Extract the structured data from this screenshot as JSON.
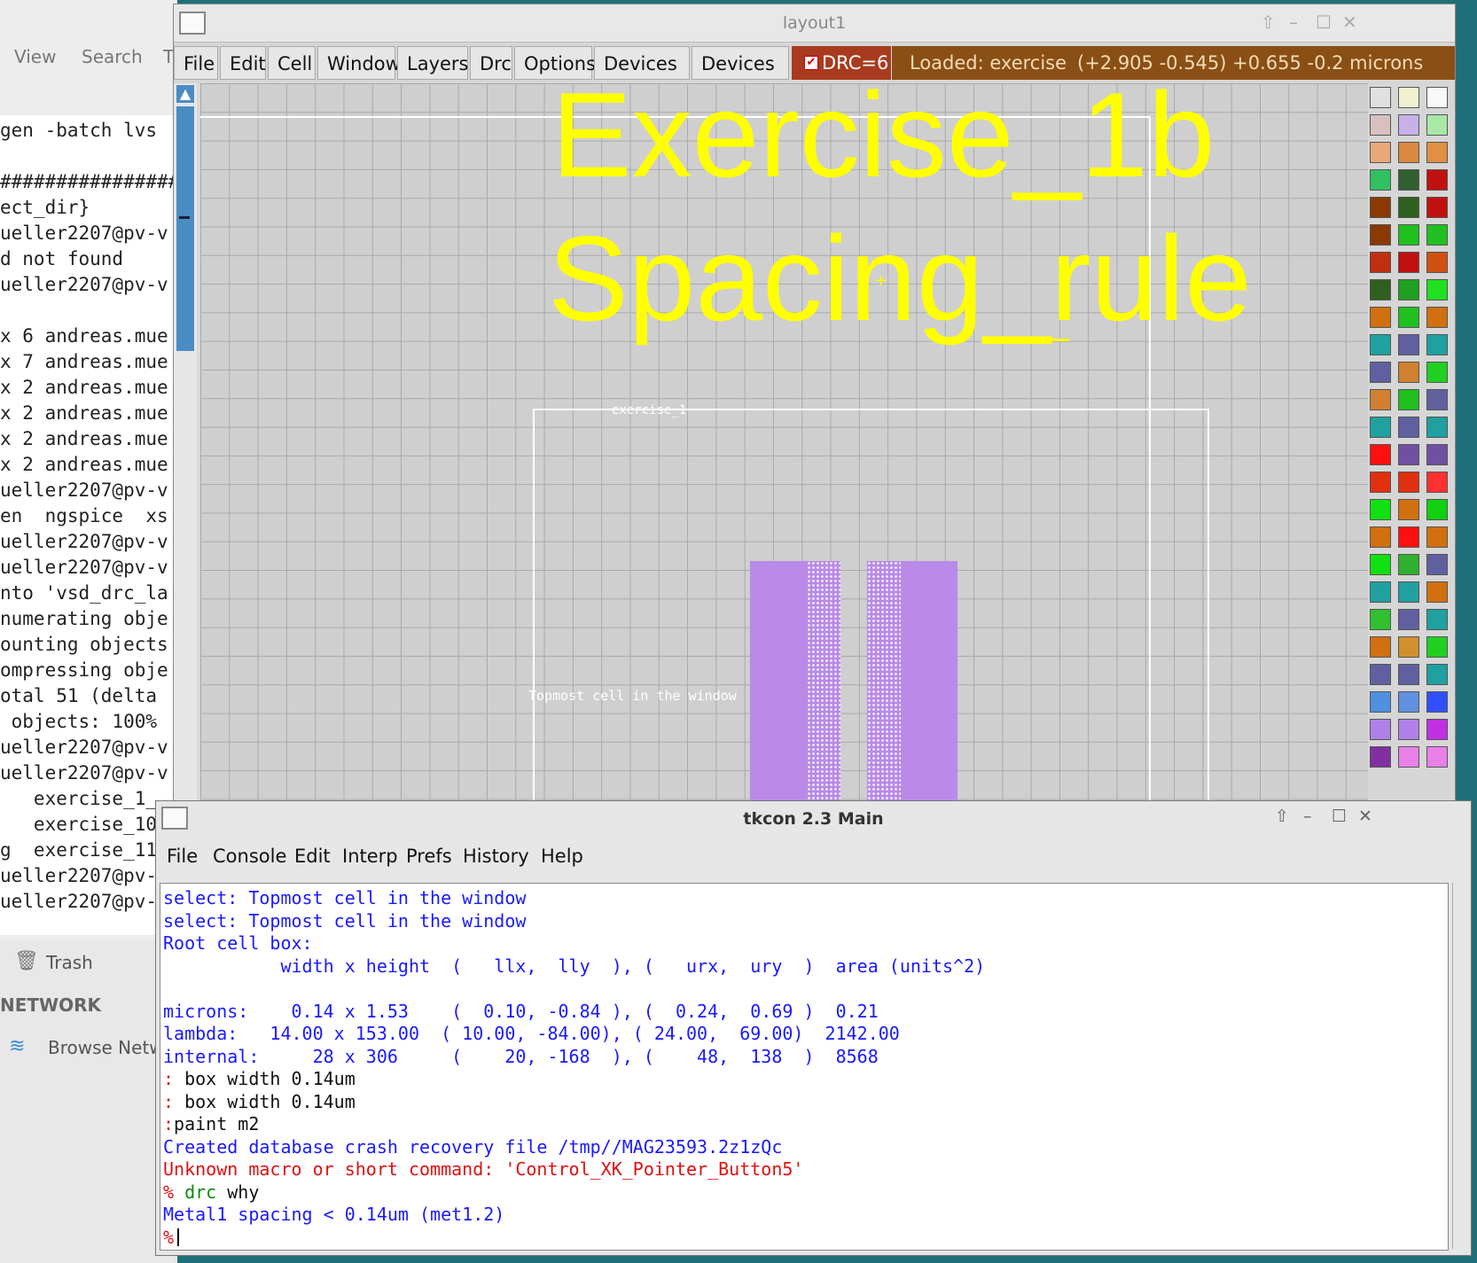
{
  "background": {
    "menu": [
      "View",
      "Search",
      "T"
    ],
    "terminal_lines": [
      "gen -batch lvs",
      "",
      "################",
      "ect_dir}",
      "ueller2207@pv-v",
      "d not found",
      "ueller2207@pv-v",
      "",
      "x 6 andreas.mue",
      "x 7 andreas.mue",
      "x 2 andreas.mue",
      "x 2 andreas.mue",
      "x 2 andreas.mue",
      "x 2 andreas.mue",
      "ueller2207@pv-v",
      "en  ngspice  xs",
      "ueller2207@pv-v",
      "ueller2207@pv-v",
      "nto 'vsd_drc_la",
      "numerating obje",
      "ounting objects",
      "ompressing obje",
      "otal 51 (delta",
      " objects: 100%",
      "ueller2207@pv-v",
      "ueller2207@pv-v",
      "   exercise_1_",
      "   exercise_10",
      "g  exercise_11",
      "ueller2207@pv-",
      "ueller2207@pv-"
    ],
    "sidebar": {
      "trash": "Trash",
      "network": "NETWORK",
      "browse": "Browse Netw"
    }
  },
  "layout": {
    "title": "layout1",
    "menu": [
      "File",
      "Edit",
      "Cell",
      "Window",
      "Layers",
      "Drc",
      "Options",
      "Devices 1",
      "Devices 2"
    ],
    "drc_label": "DRC=6",
    "status_loaded": "Loaded: exercise",
    "status_coords": "(+2.905 -0.545) +0.655 -0.2 microns",
    "canvas": {
      "title_line1": "Exercise_1b",
      "title_line2": "Spacing_rule",
      "cell_name": "exercise_1",
      "topmost_label": "Topmost cell in the window"
    }
  },
  "tkcon": {
    "title": "tkcon 2.3 Main",
    "menu": [
      "File",
      "Console",
      "Edit",
      "Interp",
      "Prefs",
      "History",
      "Help"
    ],
    "lines": [
      {
        "text": "select: Topmost cell in the window",
        "color": "blue"
      },
      {
        "text": "select: Topmost cell in the window",
        "color": "blue"
      },
      {
        "text": "Root cell box:",
        "color": "blue"
      },
      {
        "text": "           width x height  (   llx,  lly  ), (   urx,  ury  )  area (units^2)",
        "color": "blue"
      },
      {
        "text": "",
        "color": "blue"
      },
      {
        "text": "microns:    0.14 x 1.53    (  0.10, -0.84 ), (  0.24,  0.69 )  0.21",
        "color": "blue"
      },
      {
        "text": "lambda:   14.00 x 153.00  ( 10.00, -84.00), ( 24.00,  69.00)  2142.00",
        "color": "blue"
      },
      {
        "text": "internal:     28 x 306     (    20, -168  ), (    48,  138  )  8568",
        "color": "blue"
      },
      {
        "prefix": ":",
        "text": " box width 0.14um",
        "color": "black"
      },
      {
        "prefix": ":",
        "text": " box width 0.14um",
        "color": "black"
      },
      {
        "prefix": ":",
        "text": "paint m2",
        "color": "black"
      },
      {
        "text": "Created database crash recovery file /tmp//MAG23593.2z1zQc",
        "color": "blue"
      },
      {
        "text": "Unknown macro or short command: 'Control_XK_Pointer_Button5'",
        "color": "red"
      },
      {
        "prefix": "%",
        "cmd": " drc",
        "text": " why",
        "color": "black"
      },
      {
        "text": "Metal1 spacing < 0.14um (met1.2)",
        "color": "blue"
      },
      {
        "prefix": "%",
        "text": "",
        "color": "black"
      }
    ]
  }
}
